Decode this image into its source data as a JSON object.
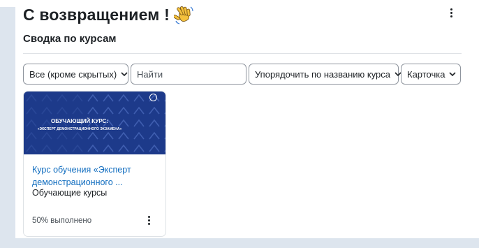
{
  "header": {
    "title": "С возвращением !",
    "wave_icon": "waving-hand-icon",
    "menu_icon": "kebab-menu-icon"
  },
  "course_overview": {
    "title": "Сводка по курсам",
    "filter_grouping": "Все (кроме скрытых)",
    "search_placeholder": "Найти",
    "sort_label": "Упорядочить по названию курса",
    "view_label": "Карточка"
  },
  "courses": [
    {
      "image_title": "ОБУЧАЮЩИЙ КУРС:",
      "image_subtitle": "«ЭКСПЕРТ ДЕМОНСТРАЦИОННОГО ЭКЗАМЕНА»",
      "name_line1": "Курс обучения «Эксперт",
      "name_line2": "демонстрационного ...",
      "category": "Обучающие курсы",
      "progress_text": "50% выполнено",
      "progress_percent": 50
    }
  ],
  "colors": {
    "link": "#0f6cbf",
    "card_image": "#1d3a8a",
    "background": "#dde5ee"
  }
}
